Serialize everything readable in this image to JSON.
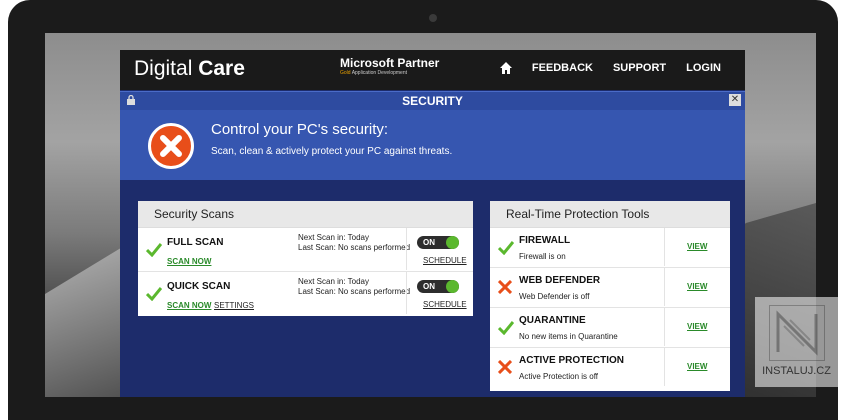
{
  "header": {
    "brand_light": "Digital",
    "brand_bold": "Care",
    "partner_title": "Microsoft Partner",
    "partner_sub_highlight": "Gold",
    "partner_sub": "Application Development",
    "nav": [
      "FEEDBACK",
      "SUPPORT",
      "LOGIN"
    ]
  },
  "security_bar": {
    "title": "SECURITY"
  },
  "hero": {
    "heading": "Control your PC's security:",
    "subtext": "Scan, clean & actively protect your PC against threats."
  },
  "scans_panel": {
    "title": "Security Scans",
    "rows": [
      {
        "name": "FULL SCAN",
        "action": "SCAN NOW",
        "next": "Next Scan in: Today",
        "last": "Last Scan: No scans performed",
        "toggle": "ON",
        "schedule": "SCHEDULE"
      },
      {
        "name": "QUICK SCAN",
        "action": "SCAN NOW",
        "settings": "SETTINGS",
        "next": "Next Scan in: Today",
        "last": "Last Scan: No scans performed",
        "toggle": "ON",
        "schedule": "SCHEDULE"
      }
    ]
  },
  "rt_panel": {
    "title_bold": "Real-Time",
    "title_rest": "Protection Tools",
    "rows": [
      {
        "name": "FIREWALL",
        "status": "Firewall is on",
        "ok": true,
        "view": "VIEW"
      },
      {
        "name": "WEB DEFENDER",
        "status": "Web Defender is off",
        "ok": false,
        "view": "VIEW"
      },
      {
        "name": "QUARANTINE",
        "status": "No new items in Quarantine",
        "ok": true,
        "view": "VIEW"
      },
      {
        "name": "ACTIVE PROTECTION",
        "status": "Active Protection is off",
        "ok": false,
        "view": "VIEW"
      }
    ]
  },
  "watermark": {
    "text": "INSTALUJ.CZ"
  },
  "colors": {
    "accent_green": "#5bb82e",
    "alert_red": "#e84e1a",
    "header_blue": "#3656b0",
    "app_bg": "#1d2c6b"
  }
}
